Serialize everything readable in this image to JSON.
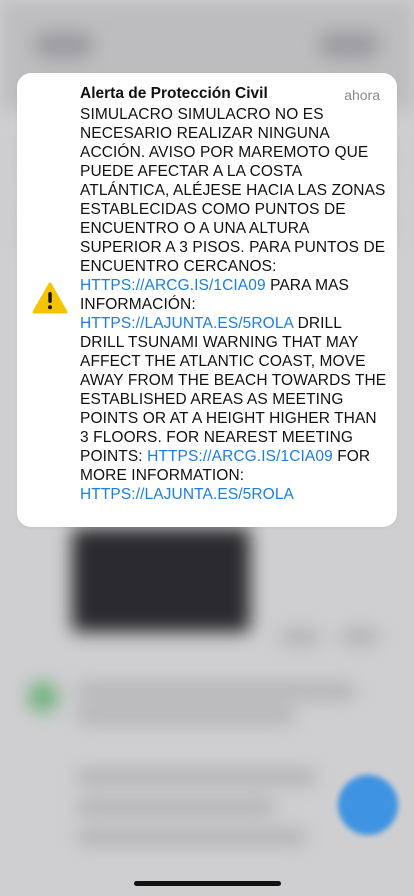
{
  "notification": {
    "title": "Alerta de Protección Civil",
    "time": "ahora",
    "icon": "warning-icon",
    "accent_color": "#1a7ee6",
    "warning_color": "#f5c400",
    "body": {
      "text_1": "SIMULACRO SIMULACRO NO ES NECESARIO REALIZAR NINGUNA ACCIÓN. AVISO POR MAREMOTO QUE PUEDE AFECTAR A LA COSTA ATLÁNTICA, ALÉJESE HACIA LAS ZONAS ESTABLECIDAS COMO PUNTOS DE ENCUENTRO O A UNA ALTURA SUPERIOR A 3 PISOS. PARA PUNTOS DE ENCUENTRO CERCANOS: ",
      "link_1": "HTTPS://ARCG.IS/1CIA09",
      "text_2": " PARA MAS INFORMACIÓN: ",
      "link_2": "HTTPS://LAJUNTA.ES/5ROLA",
      "text_3": " DRILL DRILL TSUNAMI WARNING THAT MAY AFFECT THE ATLANTIC COAST, MOVE AWAY FROM THE BEACH TOWARDS THE ESTABLISHED AREAS AS MEETING POINTS OR AT A HEIGHT HIGHER THAN 3 FLOORS. FOR NEAREST MEETING POINTS: ",
      "link_3": "HTTPS://ARCG.IS/1CIA09",
      "text_4": " FOR MORE INFORMATION: ",
      "link_4": "HTTPS://LAJUNTA.ES/5ROLA"
    }
  },
  "background": {
    "fab_color": "#2f8de4"
  }
}
